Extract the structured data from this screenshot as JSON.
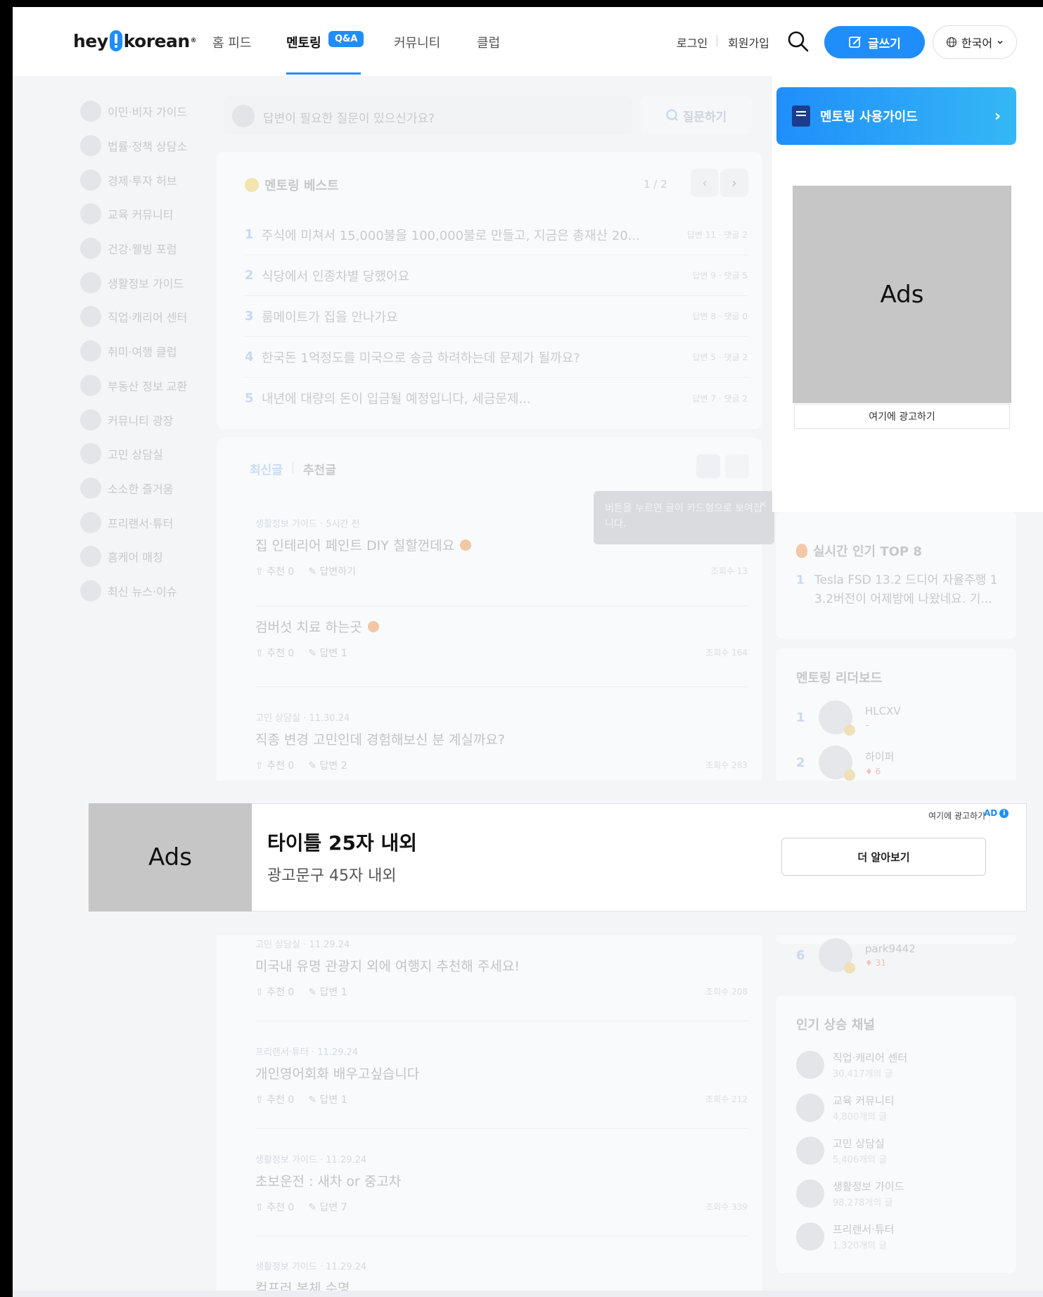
{
  "header": {
    "logo_left": "hey",
    "logo_right": "korean",
    "logo_mark": "®",
    "nav": [
      "홈 피드",
      "멘토링",
      "커뮤니티",
      "클럽"
    ],
    "qa_badge": "Q&A",
    "login": "로그인",
    "signup": "회원가입",
    "write": "글쓰기",
    "language": "한국어"
  },
  "sidebar": {
    "items": [
      "이민·비자 가이드",
      "법률·정책 상담소",
      "경제·투자 허브",
      "교육 커뮤니티",
      "건강·웰빙 포럼",
      "생활정보 가이드",
      "직업·캐리어 센터",
      "취미·여행 클럽",
      "부동산 정보 교환",
      "커뮤니티 광장",
      "고민 상담실",
      "소소한 즐거움",
      "프리랜서·튜터",
      "홈케어 매칭",
      "최신 뉴스·이슈"
    ]
  },
  "ask": {
    "placeholder": "답변이 필요한 질문이 있으신가요?",
    "button": "질문하기"
  },
  "best": {
    "title": "멘토링 베스트",
    "page": "1 / 2",
    "items": [
      {
        "rank": "1",
        "text": "주식에 미쳐서 15,000불을 100,000불로 만들고, 지금은 총재산 20...",
        "meta": "답변 11 · 댓글 2"
      },
      {
        "rank": "2",
        "text": "식당에서 인종차별 당했어요",
        "meta": "답변 9 · 댓글 5"
      },
      {
        "rank": "3",
        "text": "룸메이트가 집을 안나가요",
        "meta": "답변 8 · 댓글 0"
      },
      {
        "rank": "4",
        "text": "한국돈 1억정도를 미국으로 송금 하려하는데 문제가 될까요?",
        "meta": "답변 5 · 댓글 2"
      },
      {
        "rank": "5",
        "text": "내년에 대량의 돈이 입금될 예정입니다, 세금문제...",
        "meta": "답변 7 · 댓글 2"
      }
    ]
  },
  "tabs": {
    "latest": "최신글",
    "recommended": "추천글"
  },
  "tooltip": {
    "text": "버튼을 누르면 글이 카드형으로 보여집니다.",
    "close": "×"
  },
  "posts": [
    {
      "meta": "생활정보 가이드 · 5시간 전",
      "title": "집 인테리어 페인트 DIY 칠할껀데요",
      "recommend": "추천 0",
      "answer": "답변하기",
      "views": "조회수 13"
    },
    {
      "meta": "",
      "title": "검버섯 치료 하는곳",
      "recommend": "추천 0",
      "answer": "답변 1",
      "views": "조회수 164"
    },
    {
      "meta": "고민 상담실 · 11.30.24",
      "title": "직종 변경 고민인데 경험해보신 분 계실까요?",
      "recommend": "추천 0",
      "answer": "답변 2",
      "views": "조회수 283"
    },
    {
      "meta": "고민 상담실 · 11.29.24",
      "title": "미국내 유명 관광지 외에 여행지 추천해 주세요!",
      "recommend": "추천 0",
      "answer": "답변 1",
      "views": "조회수 208"
    },
    {
      "meta": "프리랜서·튜터 · 11.29.24",
      "title": "개인영어회화 배우고싶습니다",
      "recommend": "추천 0",
      "answer": "답변 1",
      "views": "조회수 212"
    },
    {
      "meta": "생활정보 가이드 · 11.29.24",
      "title": "초보운전 : 새차 or 중고차",
      "recommend": "추천 0",
      "answer": "답변 7",
      "views": "조회수 339"
    },
    {
      "meta": "생활정보 가이드 · 11.29.24",
      "title": "컴프러 본체 수명"
    }
  ],
  "right": {
    "guide": "멘토링 사용가이드",
    "ad_label": "Ads",
    "ad_link": "여기에 광고하기",
    "top8_title": "실시간 인기 TOP 8",
    "top8_rank": "1",
    "top8_text_1": "Tesla FSD 13.2 드디어 자율주행 1",
    "top8_text_2": "3.2버전이 어제밤에 나왔네요. 기...",
    "leaderboard_title": "멘토링 리더보드",
    "leaders": [
      {
        "rank": "1",
        "name": "HLCXV",
        "score": "–"
      },
      {
        "rank": "2",
        "name": "하이퍼",
        "score": "♦ 6"
      },
      {
        "rank": "6",
        "name": "park9442",
        "score": "♦ 31"
      }
    ],
    "channels_title": "인기 상승 채널",
    "channels": [
      {
        "name": "직업·캐리어 센터",
        "count": "30,417개의 글"
      },
      {
        "name": "교육 커뮤니티",
        "count": "4,800개의 글"
      },
      {
        "name": "고민 상담실",
        "count": "5,406개의 글"
      },
      {
        "name": "생활정보 가이드",
        "count": "98,278개의 글"
      },
      {
        "name": "프리랜서·튜터",
        "count": "1,320개의 글"
      }
    ]
  },
  "bottom_ad": {
    "image_label": "Ads",
    "title": "타이틀 25자 내외",
    "subtitle": "광고문구 45자 내외",
    "button": "더 알아보기",
    "here": "여기에 광고하기",
    "tag": "AD",
    "info": "i"
  }
}
